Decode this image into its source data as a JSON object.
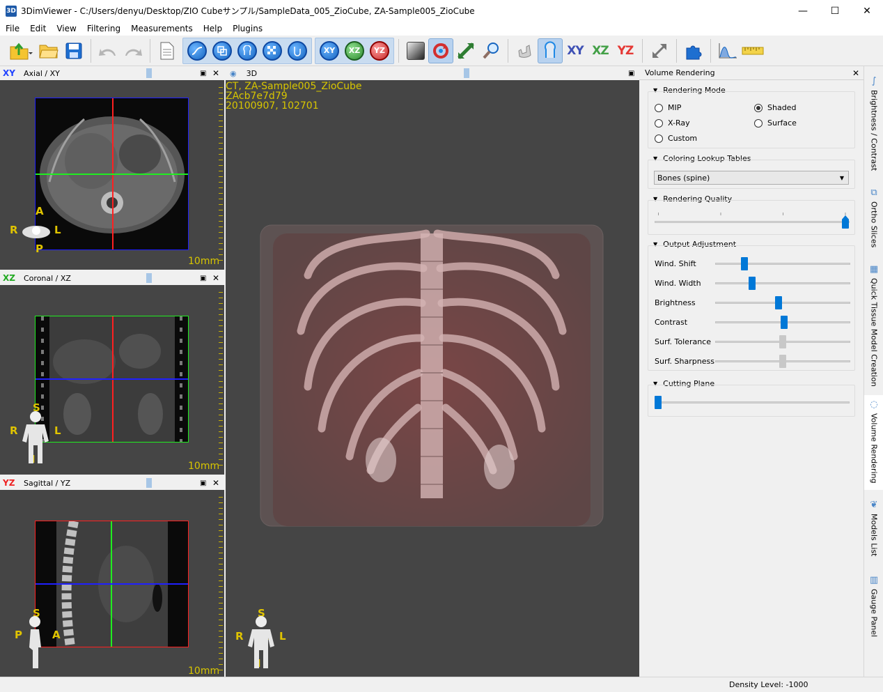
{
  "window": {
    "app_icon": "3D",
    "title": "3DimViewer - C:/Users/denyu/Desktop/ZIO Cubeサンプル/SampleData_005_ZioCube, ZA-Sample005_ZioCube",
    "minimize": "—",
    "maximize": "☐",
    "close": "✕"
  },
  "menu": [
    "File",
    "Edit",
    "View",
    "Filtering",
    "Measurements",
    "Help",
    "Plugins"
  ],
  "toolbar": {
    "icons": [
      "open-dicom-icon",
      "open-folder-icon",
      "save-icon",
      "undo-icon",
      "redo-icon",
      "new-page-icon",
      "brightness-contrast-icon",
      "ortho-slices-icon",
      "tissue-segmentation-icon",
      "checkerboard-icon",
      "volume-rendering-icon",
      "xy-slice-icon",
      "xz-slice-icon",
      "yz-slice-icon",
      "window-level-icon",
      "rotate-icon",
      "zoom-pan-icon",
      "magnifier-icon",
      "implant-icon",
      "vr-mode-icon",
      "xy-plane-icon",
      "xz-plane-icon",
      "yz-plane-icon",
      "resize-icon",
      "plugin-icon",
      "histogram-icon",
      "ruler-icon"
    ],
    "circle_labels": {
      "xy": "XY",
      "xz": "XZ",
      "yz": "YZ"
    },
    "plane_labels": {
      "xy": "XY",
      "xz": "XZ",
      "yz": "YZ"
    }
  },
  "views": {
    "axial": {
      "tag": "XY",
      "name": "Axial / XY",
      "scale": "10mm",
      "orient": {
        "top": "A",
        "bottom": "P",
        "left": "R",
        "right": "L"
      }
    },
    "coronal": {
      "tag": "XZ",
      "name": "Coronal / XZ",
      "scale": "10mm",
      "orient": {
        "top": "S",
        "bottom": "I",
        "left": "R",
        "right": "L"
      }
    },
    "sagittal": {
      "tag": "YZ",
      "name": "Sagittal / YZ",
      "scale": "10mm",
      "orient": {
        "top": "S",
        "bottom": "I",
        "left": "P",
        "right": "A"
      }
    },
    "threed": {
      "name": "3D",
      "info_lines": [
        "CT, ZA-Sample005_ZioCube",
        "ZAcb7e7d79",
        "20100907, 102701"
      ],
      "orient": {
        "top": "S",
        "bottom": "I",
        "left": "R",
        "center": "A",
        "right": "L"
      }
    },
    "close": "✕"
  },
  "panel": {
    "title": "Volume Rendering",
    "close": "✕",
    "rendering_mode": {
      "title": "Rendering Mode",
      "options": [
        {
          "label": "MIP",
          "selected": false
        },
        {
          "label": "Shaded",
          "selected": true
        },
        {
          "label": "X-Ray",
          "selected": false
        },
        {
          "label": "Surface",
          "selected": false
        },
        {
          "label": "Custom",
          "selected": false
        }
      ]
    },
    "coloring": {
      "title": "Coloring Lookup Tables",
      "selected": "Bones (spine)"
    },
    "quality": {
      "title": "Rendering Quality",
      "value": 1.0
    },
    "output": {
      "title": "Output Adjustment",
      "sliders": [
        {
          "label": "Wind. Shift",
          "value": 0.2,
          "enabled": true
        },
        {
          "label": "Wind. Width",
          "value": 0.26,
          "enabled": true
        },
        {
          "label": "Brightness",
          "value": 0.47,
          "enabled": true
        },
        {
          "label": "Contrast",
          "value": 0.51,
          "enabled": true
        },
        {
          "label": "Surf. Tolerance",
          "value": 0.5,
          "enabled": false
        },
        {
          "label": "Surf. Sharpness",
          "value": 0.5,
          "enabled": false
        }
      ]
    },
    "cutting": {
      "title": "Cutting Plane",
      "value": 0.0
    }
  },
  "side_tabs": [
    {
      "label": "Brightness / Contrast",
      "icon": "brightness-contrast-icon"
    },
    {
      "label": "Ortho Slices",
      "icon": "ortho-slices-icon"
    },
    {
      "label": "Quick Tissue Model Creation",
      "icon": "checkerboard-icon"
    },
    {
      "label": "Volume Rendering",
      "icon": "volume-rendering-icon",
      "active": true
    },
    {
      "label": "Models List",
      "icon": "models-list-icon"
    },
    {
      "label": "Gauge Panel",
      "icon": "gauge-icon"
    }
  ],
  "status": {
    "density": "Density Level: -1000"
  },
  "colors": {
    "xy_tag": "#2244ff",
    "xz_tag": "#22aa22",
    "yz_tag": "#ee2222",
    "accent": "#0078d7"
  }
}
